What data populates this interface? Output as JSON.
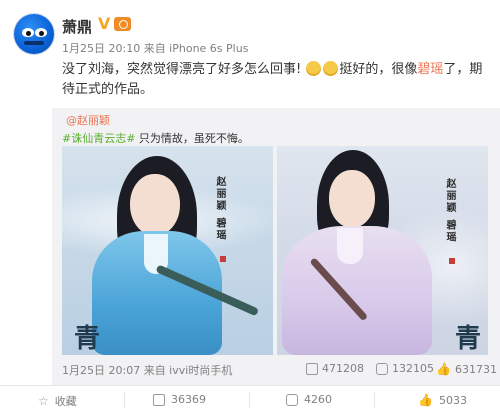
{
  "post": {
    "author": "萧鼎",
    "meta": "1月25日 20:10 来自 iPhone 6s Plus",
    "text_part1": "没了刘海，突然觉得漂亮了好多怎么回事! ",
    "text_part2": "挺好的，很像",
    "text_highlight": "碧瑶",
    "text_part3": "了，期待正式的作品。"
  },
  "repost": {
    "user": "@赵丽颖",
    "tag": "#诛仙青云志#",
    "text": " 只为情故，虽死不悔。",
    "calligraphy_left": "赵丽颖 碧瑶",
    "calligraphy_right": "赵丽颖 碧瑶",
    "corner_char_left": "青",
    "corner_char_right": "青",
    "meta": "1月25日 20:07 来自 ivvi时尚手机",
    "reposts": "471208",
    "comments": "132105",
    "likes": "631731"
  },
  "actions": {
    "favorite": "收藏",
    "repost": "36369",
    "comment": "4260",
    "like": "5033"
  },
  "colors": {
    "accent": "#eb7350",
    "tag": "#5aad2e",
    "muted": "#808080"
  }
}
